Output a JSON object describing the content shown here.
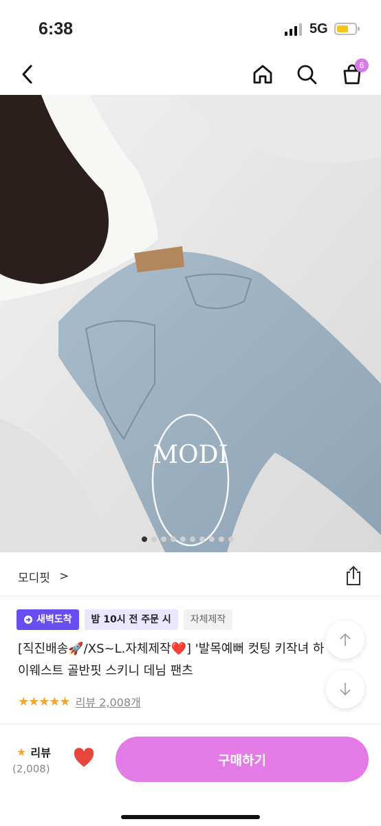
{
  "status_bar": {
    "time": "6:38",
    "network": "5G"
  },
  "header": {
    "cart_count": "6"
  },
  "hero": {
    "watermark": "MODI",
    "slide_count": 10,
    "active_slide": 0
  },
  "product": {
    "brand": "모디핏",
    "brand_chevron": ">",
    "tags": [
      "새벽도착",
      "밤 10시 전 주문 시",
      "자체제작"
    ],
    "title": "[직진배송🚀/XS~L.자체제작❤️] '발목예뻐 컷팅 키작녀 하이웨스트 골반핏 스키니 데님 팬츠",
    "stars": "★★★★★",
    "review_link": "리뷰 2,008개"
  },
  "bottom_bar": {
    "review_label": "리뷰",
    "review_count": "(2,008)",
    "buy_label": "구매하기"
  },
  "colors": {
    "accent": "#e47ae6",
    "badge": "#d978e8",
    "tag_purple": "#6a4df0",
    "star": "#f2a531",
    "heart": "#e8453c"
  }
}
